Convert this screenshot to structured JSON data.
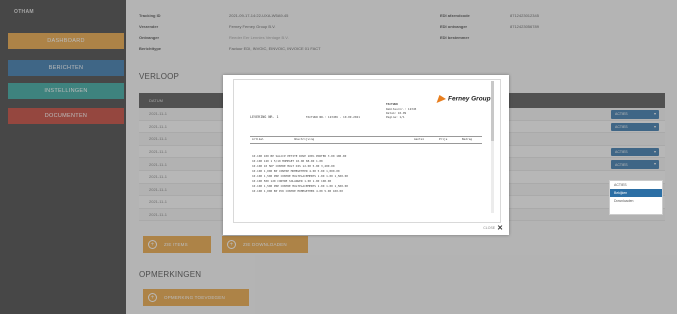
{
  "sidebar": {
    "brand": "OTHAM",
    "items": [
      {
        "label": "DASHBOARD",
        "color": "#e8a13a"
      },
      {
        "label": "BERICHTEN",
        "color": "#2c6fa5"
      },
      {
        "label": "INSTELLINGEN",
        "color": "#2aa198"
      },
      {
        "label": "DOCUMENTEN",
        "color": "#c0392b"
      }
    ]
  },
  "info": {
    "left": [
      {
        "label": "Tracking ID",
        "value": "2021-09-17-14:22-UXA-W5A9-45"
      },
      {
        "label": "Verzender",
        "value": "Ferney Ferney Group B.V."
      },
      {
        "label": "Ontvanger",
        "value": "Reeder Eer Lennies Ventage B.V."
      },
      {
        "label": "Berichttype",
        "value": "Factuur EDI, INVOIC, EINVOIC, INVOICE 01 FACT"
      }
    ],
    "right": [
      {
        "label": "EDI afzendcode",
        "value": "8712423012345"
      },
      {
        "label": "EDI ontvanger",
        "value": "8712423056789"
      },
      {
        "label": "EDI bestemmer",
        "value": ""
      }
    ]
  },
  "verloop": {
    "heading": "VERLOOP",
    "column": "DATUM",
    "rows": [
      {
        "date": "2021-11-1",
        "action": "ACTIES"
      },
      {
        "date": "2021-11-1",
        "action": "ACTIES"
      },
      {
        "date": "2021-11-1",
        "action": ""
      },
      {
        "date": "2021-11-1",
        "action": "ACTIES"
      },
      {
        "date": "2021-11-1",
        "action": "ACTIES"
      },
      {
        "date": "2021-11-1",
        "action": ""
      },
      {
        "date": "2021-11-1",
        "action": ""
      },
      {
        "date": "2021-11-1",
        "action": ""
      },
      {
        "date": "2021-11-1",
        "action": ""
      }
    ],
    "btn_add": "ZIE ITEMS",
    "btn_download": "ZIE DOWNLOADEN"
  },
  "opmerkingen": {
    "heading": "OPMERKINGEN",
    "btn": "OPMERKING TOEVOEGEN"
  },
  "dropdown": {
    "label": "ACTIES",
    "options": [
      "Bekijken",
      "Downloaden"
    ]
  },
  "modal": {
    "logo_text": "Ferney Group",
    "close_label": "CLOSE",
    "doc_header": {
      "left": "LEVERING NR. 1",
      "mid": "FACTUUR NR.: 123456 - 10-09-2021",
      "right_title": "FACTUUR",
      "right_lines": [
        "Debiteurnr.: 12345",
        "Datum: 10-09",
        "Pagina: 1/1"
      ]
    },
    "table_head": [
      "Artikel",
      "Omschrijving",
      "Aantal",
      "Prijs",
      "Bedrag"
    ],
    "doc_lines": [
      "10.100  100  BP  SALCCP   PETITE ROSE 100% PORTER  3.00  100.00",
      "10.100  120  1 5/10   MOMEGET         10.00  88.00  1.00",
      "10.100  10  5DF   CONTRE MULT DIS   12.00  5.00  3,400.00",
      "10.100  1,000  BP  CONTRE   MOMEGETHER  4.00  5.00  1,000.00",
      "10.100  1,500  PRP  CONTRE MULTPLACEMENTS  1.00  1.00  1,500.00",
      "10.100  500  120  CONTRE   SOLANGER   1.00  1.00  100.00",
      "10.100  1,500  PRP  CONTRE MULTPLACEMENTS  1.00  1.00  1,500.00",
      "10.100  1,000  BP  PCK   CONTRE MOMEGETHER  4.00  5.00  100.00"
    ]
  }
}
